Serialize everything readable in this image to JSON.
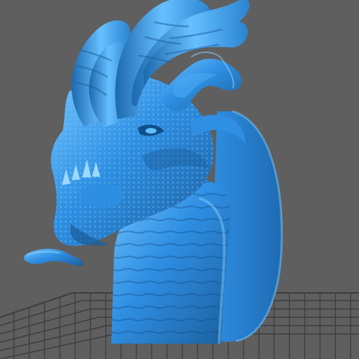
{
  "viewport": {
    "background": "#5f5f5f",
    "grid_color": "#3d3d3d",
    "model_color": "#2f8fe3",
    "model_highlight": "#6fc3ff",
    "model_shadow": "#1b5e9d"
  },
  "scene": {
    "icons": [
      "3d-model-dragon-bust",
      "build-plate-grid",
      "base-plaque"
    ]
  }
}
